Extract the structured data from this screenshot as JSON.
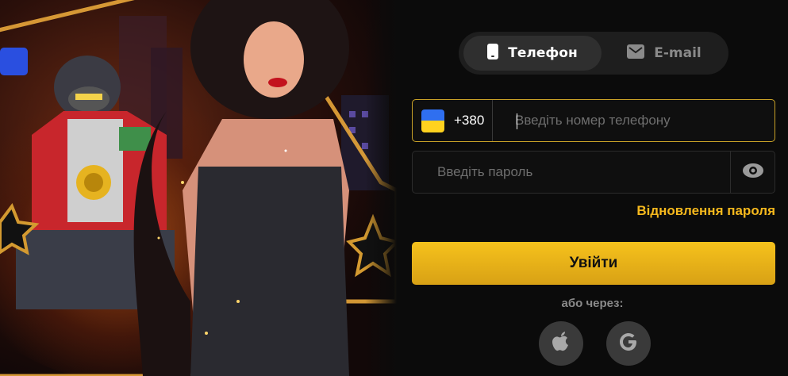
{
  "login": {
    "tabs": [
      {
        "label": "Телефон",
        "icon": "phone-icon",
        "active": true
      },
      {
        "label": "E-mail",
        "icon": "mail-icon",
        "active": false
      }
    ],
    "phone": {
      "country_flag": "ukraine-flag-icon",
      "country_code": "+380",
      "placeholder": "Введіть номер телефону",
      "value": ""
    },
    "password": {
      "placeholder": "Введіть пароль",
      "value": "",
      "toggle_icon": "eye-icon"
    },
    "forgot_link": "Відновлення пароля",
    "submit_label": "Увійти",
    "or_text": "або через:",
    "social": [
      {
        "name": "Apple",
        "icon": "apple-icon"
      },
      {
        "name": "Google",
        "icon": "google-icon"
      }
    ]
  },
  "colors": {
    "accent": "#f5b81d",
    "button": "#f0b91a",
    "panel_bg": "#0b0b0b",
    "field_border_focus": "#c9a227",
    "muted_text": "#8a8a8a"
  }
}
